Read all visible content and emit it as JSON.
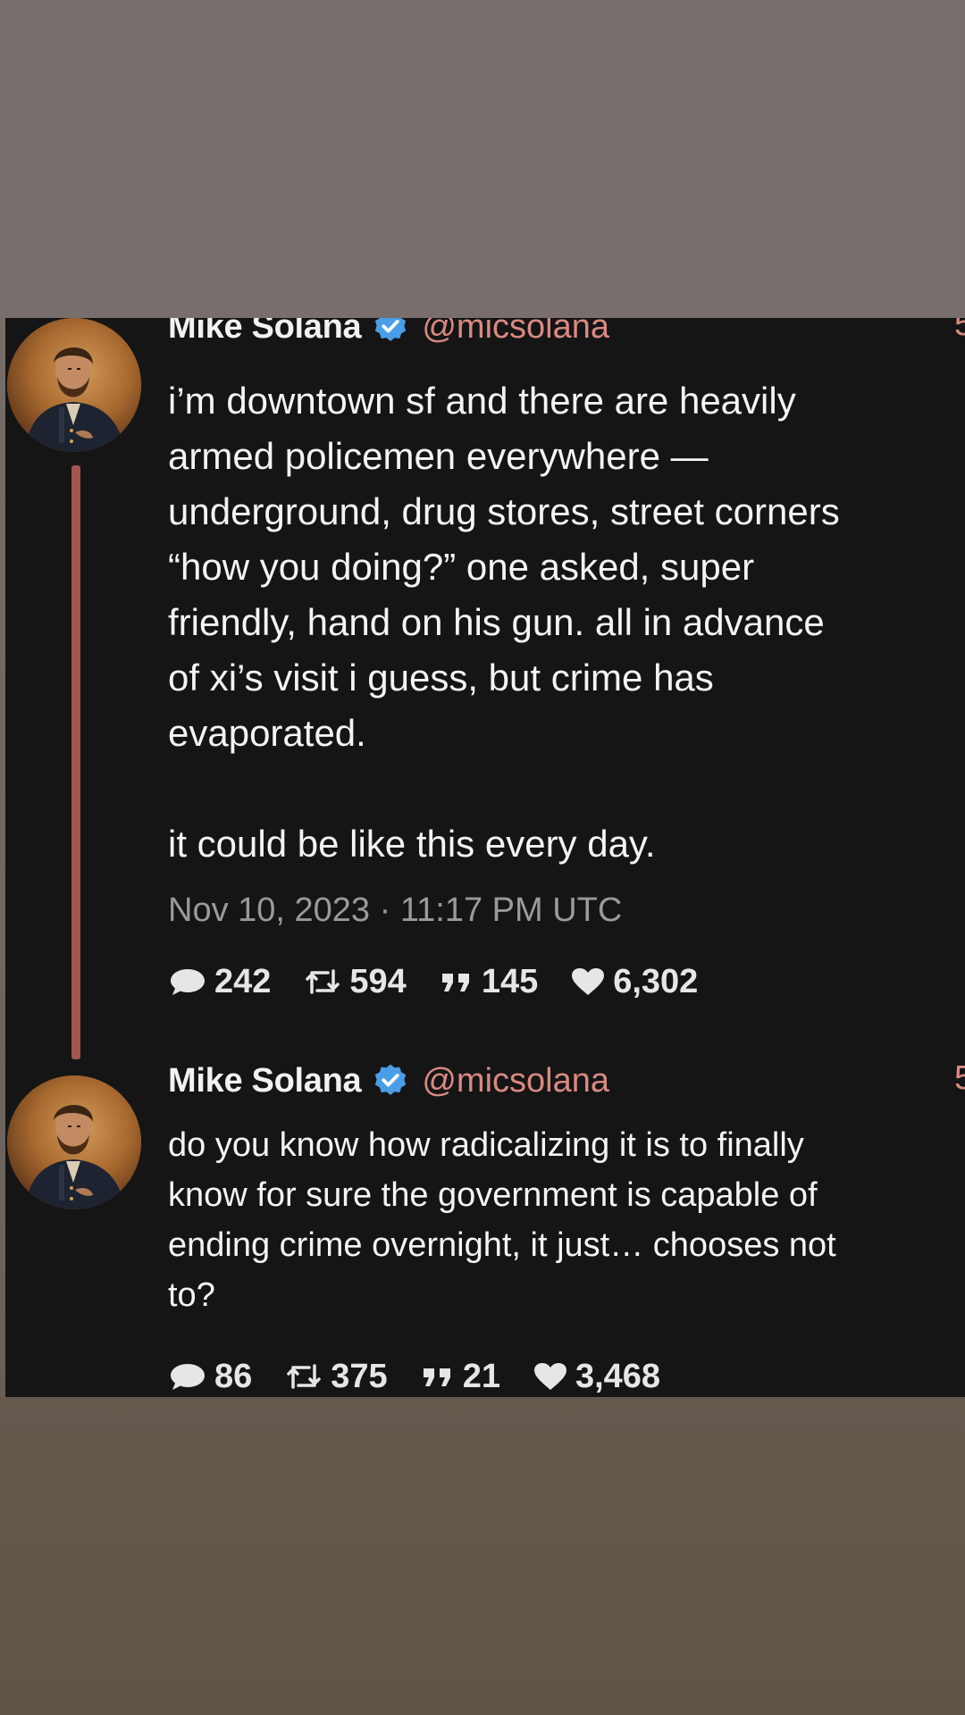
{
  "colors": {
    "card_background": "#151515",
    "handle": "#d98981",
    "thread_line": "#a4554f",
    "verified_badge": "#4a9ee8",
    "timestamp": "#9a9a9a"
  },
  "tweets": [
    {
      "author": {
        "name": "Mike Solana",
        "handle": "@micsolana",
        "verified": true,
        "avatar_icon": "portrait-avatar"
      },
      "clipped_char": "5",
      "text_lines": [
        "i’m downtown sf and there are heavily",
        "armed policemen everywhere —",
        "underground, drug stores, street corners",
        "“how you doing?” one asked, super",
        "friendly, hand on his gun. all in advance",
        "of xi’s visit i guess, but crime has",
        "evaporated."
      ],
      "text_lines_after_break": [
        "it could be like this every day."
      ],
      "timestamp": "Nov 10, 2023 · 11:17 PM UTC",
      "stats": {
        "replies": "242",
        "retweets": "594",
        "quotes": "145",
        "likes": "6,302"
      }
    },
    {
      "author": {
        "name": "Mike Solana",
        "handle": "@micsolana",
        "verified": true,
        "avatar_icon": "portrait-avatar"
      },
      "clipped_char": "5",
      "text_lines": [
        "do you know how radicalizing it is to finally",
        "know for sure the government is capable of",
        "ending crime overnight, it just… chooses not",
        "to?"
      ],
      "stats": {
        "replies": "86",
        "retweets": "375",
        "quotes": "21",
        "likes": "3,468"
      }
    }
  ]
}
